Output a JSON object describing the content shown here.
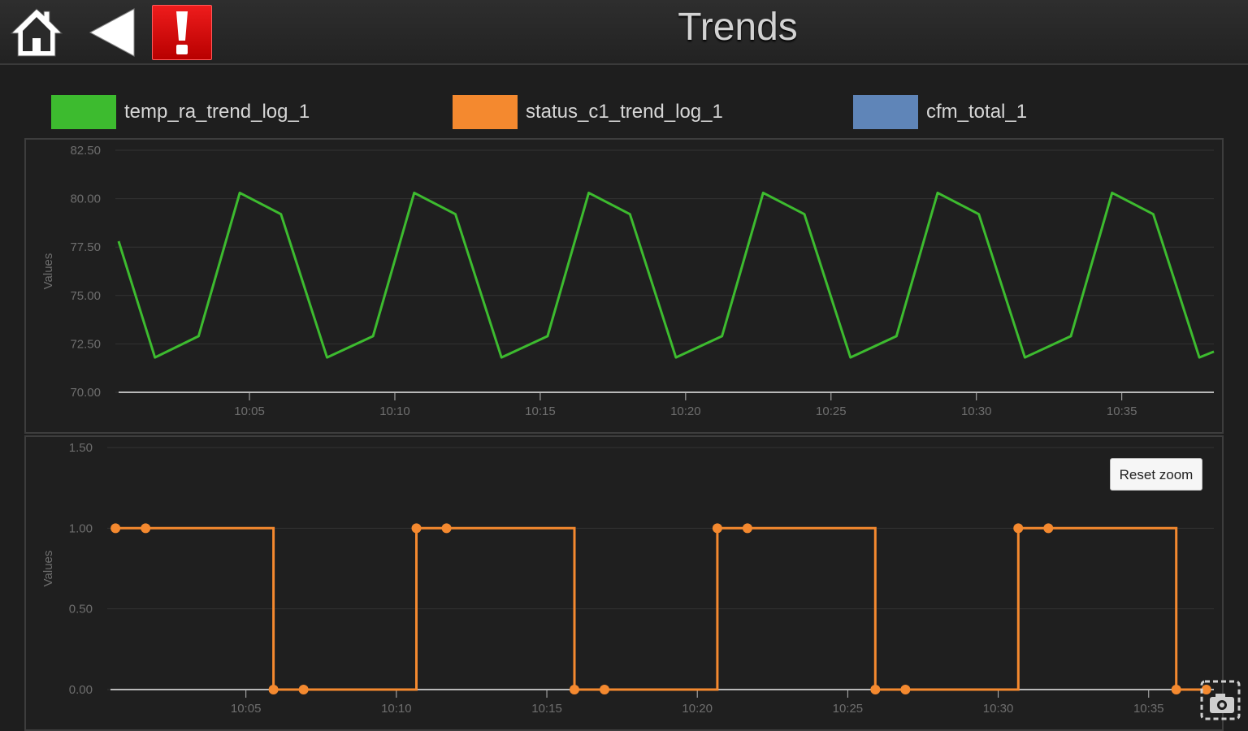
{
  "header": {
    "title": "Trends",
    "home_icon": "home-icon",
    "back_icon": "back-arrow-icon",
    "alert_icon": "alert-exclamation-icon"
  },
  "legend": [
    {
      "label": "temp_ra_trend_log_1",
      "color": "#3dbb2f"
    },
    {
      "label": "status_c1_trend_log_1",
      "color": "#f4892f"
    },
    {
      "label": "cfm_total_1",
      "color": "#5f85b8"
    }
  ],
  "reset_zoom_label": "Reset zoom",
  "camera_icon": "camera-icon",
  "chart_data": [
    {
      "type": "line",
      "series": [
        {
          "name": "temp_ra_trend_log_1",
          "color": "#3dbb2f",
          "x": [
            "10:00:30",
            "10:01:45",
            "10:03:15",
            "10:04:40",
            "10:06:05",
            "10:07:40",
            "10:09:15",
            "10:10:40",
            "10:12:05",
            "10:13:40",
            "10:15:15",
            "10:16:40",
            "10:18:05",
            "10:19:40",
            "10:21:15",
            "10:22:40",
            "10:24:05",
            "10:25:40",
            "10:27:15",
            "10:28:40",
            "10:30:05",
            "10:31:40",
            "10:33:15",
            "10:34:40",
            "10:36:05",
            "10:37:40",
            "10:38:10"
          ],
          "values": [
            77.8,
            71.8,
            72.9,
            80.3,
            79.2,
            71.8,
            72.9,
            80.3,
            79.2,
            71.8,
            72.9,
            80.3,
            79.2,
            71.8,
            72.9,
            80.3,
            79.2,
            71.8,
            72.9,
            80.3,
            79.2,
            71.8,
            72.9,
            80.3,
            79.2,
            71.8,
            72.1
          ]
        }
      ],
      "ylabel": "Values",
      "ylim": [
        70,
        82.5
      ],
      "yticks": [
        "70.00",
        "72.50",
        "75.00",
        "77.50",
        "80.00",
        "82.50"
      ],
      "xticks": [
        "10:05",
        "10:10",
        "10:15",
        "10:20",
        "10:25",
        "10:30",
        "10:35"
      ],
      "xlim": [
        "10:00:30",
        "10:38:10"
      ],
      "grid": true
    },
    {
      "type": "line",
      "step": true,
      "series": [
        {
          "name": "status_c1_trend_log_1",
          "color": "#f4892f",
          "points": [
            {
              "x": "10:00:40",
              "y": 1,
              "marker": true
            },
            {
              "x": "10:01:40",
              "y": 1,
              "marker": true
            },
            {
              "x": "10:05:55",
              "y": 1,
              "marker": false
            },
            {
              "x": "10:05:55",
              "y": 0,
              "marker": true
            },
            {
              "x": "10:06:55",
              "y": 0,
              "marker": true
            },
            {
              "x": "10:10:40",
              "y": 0,
              "marker": false
            },
            {
              "x": "10:10:40",
              "y": 1,
              "marker": true
            },
            {
              "x": "10:11:40",
              "y": 1,
              "marker": true
            },
            {
              "x": "10:15:55",
              "y": 1,
              "marker": false
            },
            {
              "x": "10:15:55",
              "y": 0,
              "marker": true
            },
            {
              "x": "10:16:55",
              "y": 0,
              "marker": true
            },
            {
              "x": "10:20:40",
              "y": 0,
              "marker": false
            },
            {
              "x": "10:20:40",
              "y": 1,
              "marker": true
            },
            {
              "x": "10:21:40",
              "y": 1,
              "marker": true
            },
            {
              "x": "10:25:55",
              "y": 1,
              "marker": false
            },
            {
              "x": "10:25:55",
              "y": 0,
              "marker": true
            },
            {
              "x": "10:26:55",
              "y": 0,
              "marker": true
            },
            {
              "x": "10:30:40",
              "y": 0,
              "marker": false
            },
            {
              "x": "10:30:40",
              "y": 1,
              "marker": true
            },
            {
              "x": "10:31:40",
              "y": 1,
              "marker": true
            },
            {
              "x": "10:35:55",
              "y": 1,
              "marker": false
            },
            {
              "x": "10:35:55",
              "y": 0,
              "marker": true
            },
            {
              "x": "10:36:55",
              "y": 0,
              "marker": true
            }
          ]
        }
      ],
      "ylabel": "Values",
      "ylim": [
        0,
        1.5
      ],
      "yticks": [
        "0.00",
        "0.50",
        "1.00",
        "1.50"
      ],
      "xticks": [
        "10:05",
        "10:10",
        "10:15",
        "10:20",
        "10:25",
        "10:30",
        "10:35"
      ],
      "xlim": [
        "10:00:30",
        "10:37:10"
      ],
      "grid": true
    }
  ]
}
